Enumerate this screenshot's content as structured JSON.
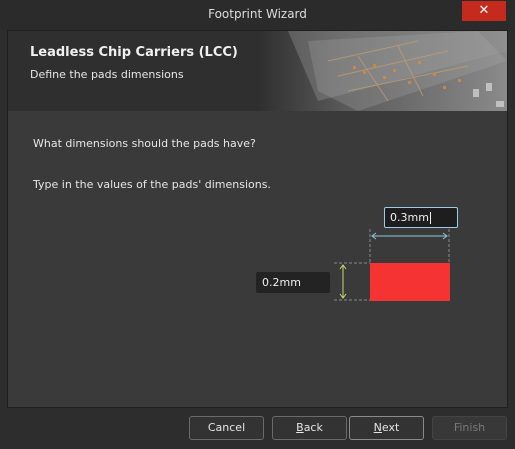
{
  "window": {
    "title": "Footprint Wizard",
    "close_label": "✕"
  },
  "banner": {
    "heading": "Leadless Chip Carriers (LCC)",
    "subheading": "Define the pads dimensions"
  },
  "content": {
    "question": "What dimensions should the pads have?",
    "instruction": "Type in the values of the pads' dimensions.",
    "pad_width": "0.3mm",
    "pad_height": "0.2mm",
    "pad_color": "#f53333",
    "dimension_line_color_width": "#8ec7d6",
    "dimension_line_color_height": "#c8d86a"
  },
  "footer": {
    "cancel": "Cancel",
    "back_first": "B",
    "back_rest": "ack",
    "next_first": "N",
    "next_rest": "ext",
    "finish": "Finish"
  }
}
